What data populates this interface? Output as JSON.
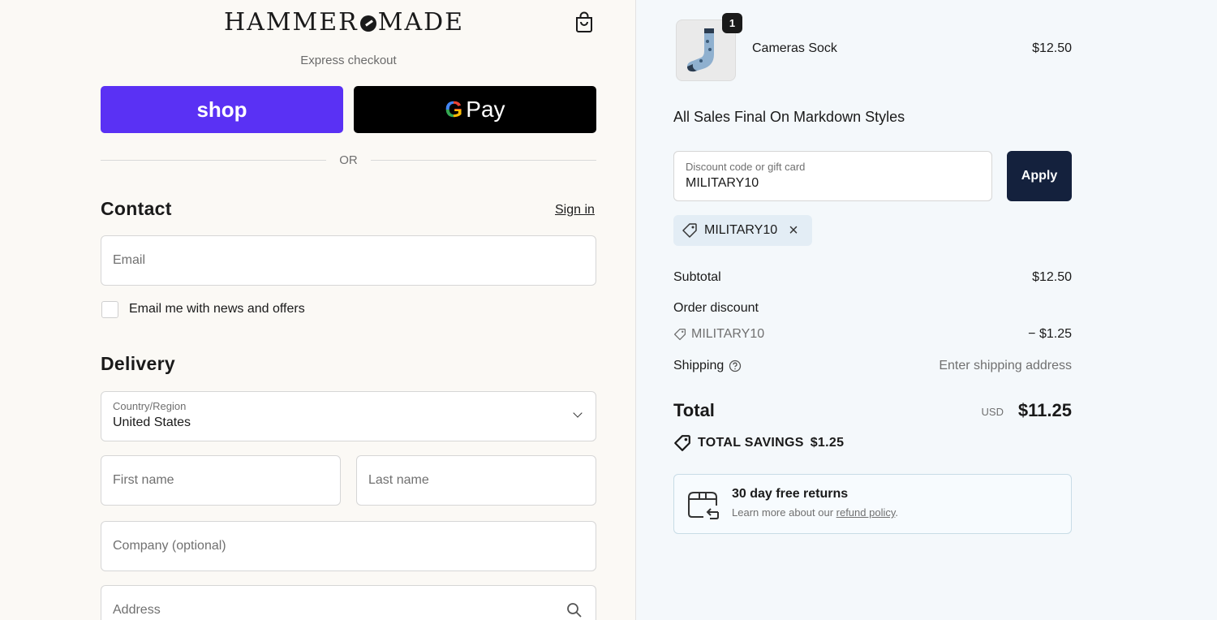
{
  "brand": {
    "left": "HAMMER",
    "right": "MADE"
  },
  "express": {
    "title": "Express checkout",
    "shop_label": "shop",
    "gpay_g": "G",
    "gpay_label": "Pay",
    "divider": "OR"
  },
  "contact": {
    "heading": "Contact",
    "signin": "Sign in",
    "email_placeholder": "Email",
    "newsletter_label": "Email me with news and offers",
    "newsletter_checked": false
  },
  "delivery": {
    "heading": "Delivery",
    "country_label": "Country/Region",
    "country_value": "United States",
    "first_name_placeholder": "First name",
    "last_name_placeholder": "Last name",
    "company_placeholder": "Company (optional)",
    "address_placeholder": "Address"
  },
  "order": {
    "item": {
      "name": "Cameras Sock",
      "price": "$12.50",
      "quantity": "1"
    },
    "notice": "All Sales Final On Markdown Styles",
    "discount": {
      "label": "Discount code or gift card",
      "value": "MILITARY10",
      "apply_label": "Apply",
      "applied_code": "MILITARY10"
    },
    "summary": {
      "subtotal_label": "Subtotal",
      "subtotal_value": "$12.50",
      "order_discount_label": "Order discount",
      "discount_code": "MILITARY10",
      "discount_value": "− $1.25",
      "shipping_label": "Shipping",
      "shipping_value": "Enter shipping address",
      "total_label": "Total",
      "total_currency": "USD",
      "total_value": "$11.25",
      "savings_label": "TOTAL SAVINGS",
      "savings_value": "$1.25"
    },
    "returns": {
      "title": "30 day free returns",
      "text": "Learn more about our ",
      "link": "refund policy",
      "after": "."
    }
  },
  "colors": {
    "shop": "#5a31f4",
    "gpay": "#000000",
    "apply": "#14213d",
    "chip": "#e3edf5",
    "summary_bg": "#f4f8fb",
    "form_bg": "#fbf9f5"
  }
}
